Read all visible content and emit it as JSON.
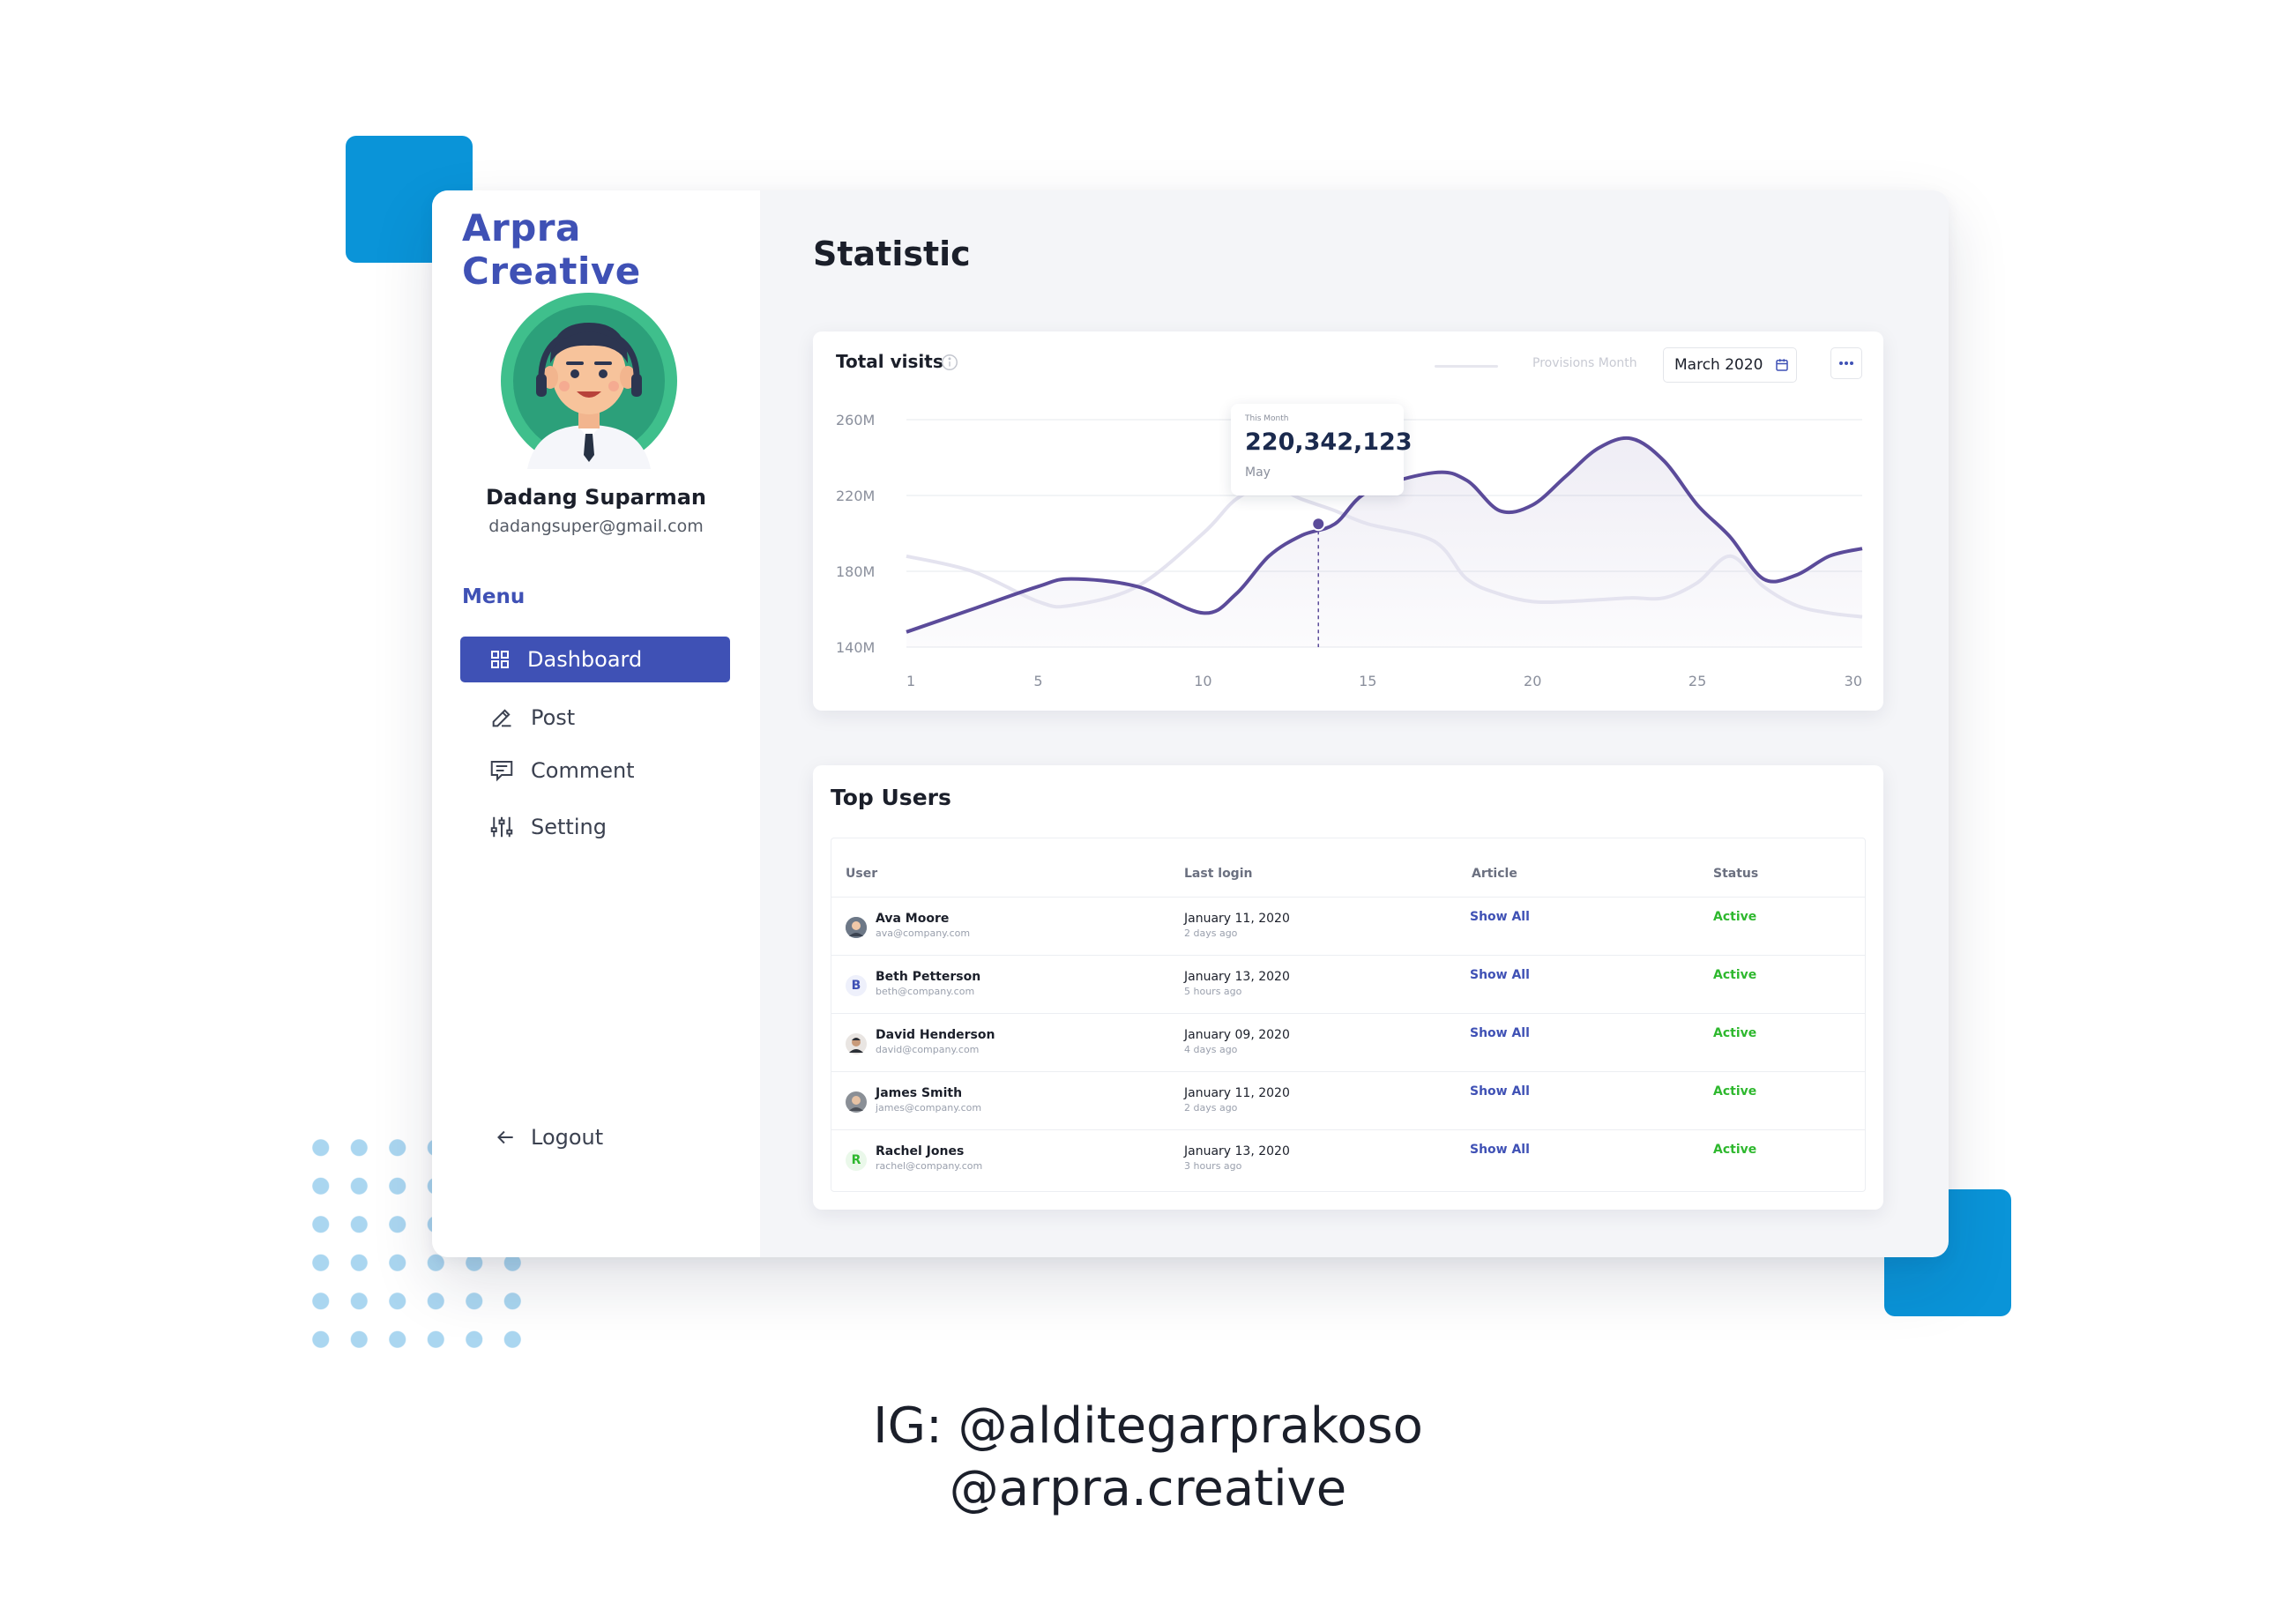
{
  "colors": {
    "accent": "#3f51b5",
    "deco_blue": "#0a94d8",
    "line_primary": "#5b4b9a",
    "line_secondary": "#e4e3ef",
    "status_active": "#2eb82e"
  },
  "sidebar": {
    "brand": "Arpra Creative",
    "user": {
      "name": "Dadang Suparman",
      "email": "dadangsuper@gmail.com"
    },
    "menu_label": "Menu",
    "items": [
      {
        "label": "Dashboard",
        "icon": "grid-icon",
        "active": true
      },
      {
        "label": "Post",
        "icon": "pencil-icon",
        "active": false
      },
      {
        "label": "Comment",
        "icon": "comment-icon",
        "active": false
      },
      {
        "label": "Setting",
        "icon": "sliders-icon",
        "active": false
      }
    ],
    "logout": {
      "label": "Logout",
      "icon": "arrow-left-icon"
    }
  },
  "main": {
    "page_title": "Statistic",
    "chart_card": {
      "title": "Total visits",
      "legend_label": "Provisions Month",
      "month": "March 2020",
      "tooltip": {
        "label": "This Month",
        "value": "220,342,123",
        "month": "May"
      }
    },
    "users_card": {
      "title": "Top Users",
      "columns": [
        "User",
        "Last login",
        "Article",
        "Status"
      ],
      "rows": [
        {
          "name": "Ava Moore",
          "email": "ava@company.com",
          "date": "January 11, 2020",
          "ago": "2 days ago",
          "article": "Show All",
          "status": "Active",
          "avatar": "photo"
        },
        {
          "name": "Beth Petterson",
          "email": "beth@company.com",
          "date": "January 13, 2020",
          "ago": "5 hours ago",
          "article": "Show All",
          "status": "Active",
          "avatar": "B"
        },
        {
          "name": "David Henderson",
          "email": "david@company.com",
          "date": "January 09, 2020",
          "ago": "4 days ago",
          "article": "Show All",
          "status": "Active",
          "avatar": "photo"
        },
        {
          "name": "James Smith",
          "email": "james@company.com",
          "date": "January 11, 2020",
          "ago": "2 days ago",
          "article": "Show All",
          "status": "Active",
          "avatar": "photo"
        },
        {
          "name": "Rachel Jones",
          "email": "rachel@company.com",
          "date": "January 13, 2020",
          "ago": "3 hours ago",
          "article": "Show All",
          "status": "Active",
          "avatar": "R"
        }
      ]
    }
  },
  "footer": {
    "line1": "IG: @alditegarprakoso",
    "line2": "@arpra.creative"
  },
  "chart_data": {
    "type": "line",
    "x_ticks": [
      1,
      5,
      10,
      15,
      20,
      25,
      30
    ],
    "y_ticks": [
      "260M",
      "220M",
      "180M",
      "140M"
    ],
    "ylim": [
      140,
      260
    ],
    "xlim": [
      1,
      30
    ],
    "grid": true,
    "highlight": {
      "x": 13.5,
      "y": 205
    },
    "series": [
      {
        "x": [
          1,
          3,
          5,
          6,
          8,
          10,
          11,
          12,
          13,
          14,
          15,
          17,
          18,
          19,
          20,
          21,
          22,
          23,
          24,
          25,
          26,
          27,
          28,
          29,
          30
        ],
        "y": [
          148,
          160,
          172,
          176,
          172,
          158,
          168,
          188,
          199,
          205,
          222,
          232,
          228,
          212,
          215,
          230,
          245,
          250,
          238,
          215,
          198,
          176,
          178,
          188,
          192
        ]
      },
      {
        "x": [
          1,
          3,
          5,
          6,
          8,
          10,
          11,
          12,
          13,
          14,
          15,
          17,
          18,
          19,
          20,
          21,
          22,
          23,
          24,
          25,
          26,
          27,
          28,
          29,
          30
        ],
        "y": [
          188,
          180,
          164,
          162,
          172,
          200,
          218,
          225,
          218,
          212,
          205,
          196,
          176,
          168,
          164,
          164,
          165,
          166,
          166,
          174,
          188,
          172,
          162,
          158,
          156
        ]
      }
    ]
  }
}
